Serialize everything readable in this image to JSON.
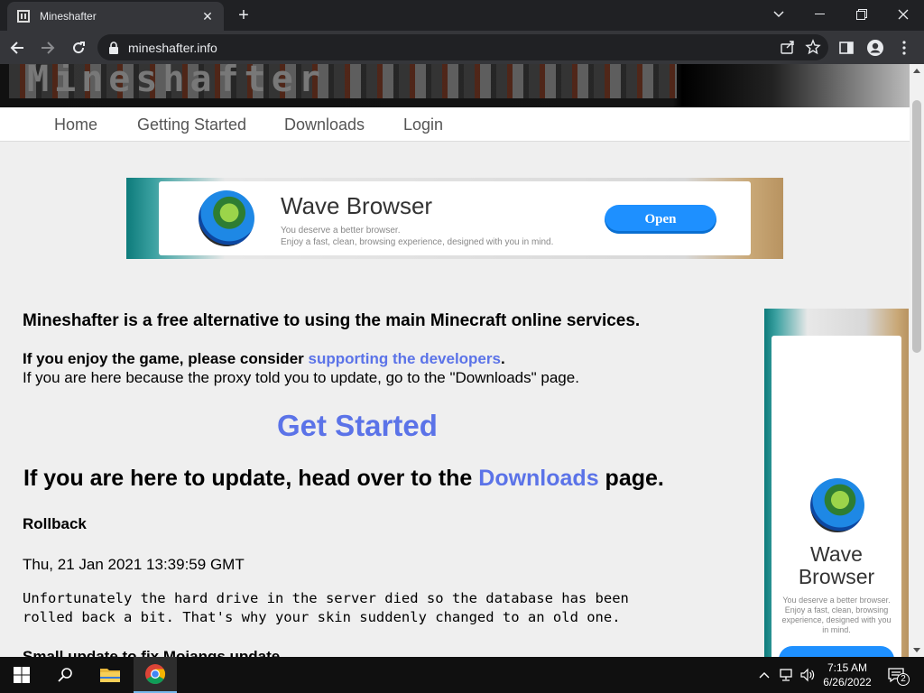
{
  "browser": {
    "tab_title": "Mineshafter",
    "url": "mineshafter.info"
  },
  "banner": {
    "logo_text": "Mineshafter"
  },
  "nav": {
    "items": [
      {
        "label": "Home"
      },
      {
        "label": "Getting Started"
      },
      {
        "label": "Downloads"
      },
      {
        "label": "Login"
      }
    ]
  },
  "ad_top": {
    "title": "Wave Browser",
    "line1": "You deserve a better browser.",
    "line2": "Enjoy a fast, clean, browsing experience, designed with you in mind.",
    "button": "Open"
  },
  "main": {
    "intro": "Mineshafter is a free alternative to using the main Minecraft online services.",
    "enjoy_prefix": "If you enjoy the game, please consider ",
    "enjoy_link": "supporting the developers",
    "enjoy_suffix": ".",
    "proxy_text": "If you are here because the proxy told you to update, go to the \"Downloads\" page.",
    "get_started": "Get Started",
    "update_prefix": "If you are here to update, head over to the ",
    "update_link": "Downloads",
    "update_suffix": " page.",
    "rollback_title": "Rollback",
    "rollback_date": "Thu, 21 Jan 2021 13:39:59 GMT",
    "rollback_line1": "Unfortunately the hard drive in the server died so the database has been",
    "rollback_line2": "rolled back a bit. That's why your skin suddenly changed to an old one.",
    "next_title": "Small update to fix Mojangs update"
  },
  "ad_side": {
    "title_line1": "Wave",
    "title_line2": "Browser",
    "text": "You deserve a better browser. Enjoy a fast, clean, browsing experience, designed with you in mind."
  },
  "taskbar": {
    "time": "7:15 AM",
    "date": "6/26/2022",
    "notification_count": "2"
  },
  "colors": {
    "link": "#5b73e8",
    "chrome_dark": "#202124",
    "chrome_toolbar": "#35363a",
    "ad_button": "#1e90ff"
  }
}
